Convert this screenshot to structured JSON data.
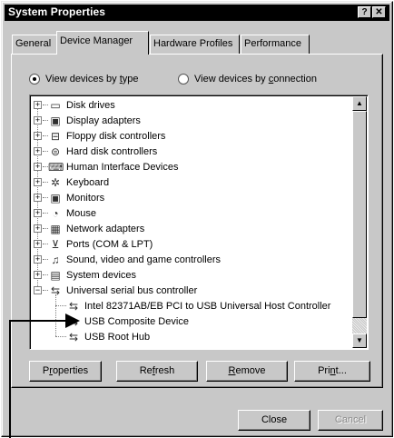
{
  "window": {
    "title": "System Properties",
    "help_glyph": "?",
    "close_glyph": "✕"
  },
  "tabs": [
    {
      "label": "General",
      "active": false
    },
    {
      "label": "Device Manager",
      "active": true
    },
    {
      "label": "Hardware Profiles",
      "active": false
    },
    {
      "label": "Performance",
      "active": false
    }
  ],
  "view_options": {
    "by_type": {
      "prefix": "View devices by ",
      "mnemonic": "t",
      "suffix": "ype",
      "selected": true
    },
    "by_connection": {
      "prefix": "View devices by ",
      "mnemonic": "c",
      "suffix": "onnection",
      "selected": false
    }
  },
  "device_tree": {
    "categories": [
      {
        "label": "Disk drives",
        "icon": "disk-drive-icon"
      },
      {
        "label": "Display adapters",
        "icon": "monitor-icon"
      },
      {
        "label": "Floppy disk controllers",
        "icon": "floppy-controller-icon"
      },
      {
        "label": "Hard disk controllers",
        "icon": "hard-disk-controller-icon"
      },
      {
        "label": "Human Interface Devices",
        "icon": "hid-icon"
      },
      {
        "label": "Keyboard",
        "icon": "keyboard-icon"
      },
      {
        "label": "Monitors",
        "icon": "monitor-icon"
      },
      {
        "label": "Mouse",
        "icon": "mouse-icon"
      },
      {
        "label": "Network adapters",
        "icon": "network-adapter-icon"
      },
      {
        "label": "Ports (COM & LPT)",
        "icon": "port-icon"
      },
      {
        "label": "Sound, video and game controllers",
        "icon": "sound-icon"
      },
      {
        "label": "System devices",
        "icon": "system-devices-icon"
      },
      {
        "label": "Universal serial bus controller",
        "icon": "usb-icon",
        "expanded": true
      }
    ],
    "usb_children": [
      {
        "label": "Intel 82371AB/EB PCI to USB Universal Host Controller",
        "icon": "usb-icon"
      },
      {
        "label": "USB Composite Device",
        "icon": "usb-icon"
      },
      {
        "label": "USB Root Hub",
        "icon": "usb-icon"
      }
    ]
  },
  "action_buttons": {
    "properties": {
      "pre": "P",
      "mn": "r",
      "post": "operties"
    },
    "refresh": {
      "pre": "Re",
      "mn": "f",
      "post": "resh"
    },
    "remove": {
      "pre": "",
      "mn": "R",
      "post": "emove"
    },
    "print": {
      "pre": "Pri",
      "mn": "n",
      "post": "t..."
    }
  },
  "dialog_buttons": {
    "close": "Close",
    "cancel": "Cancel"
  }
}
